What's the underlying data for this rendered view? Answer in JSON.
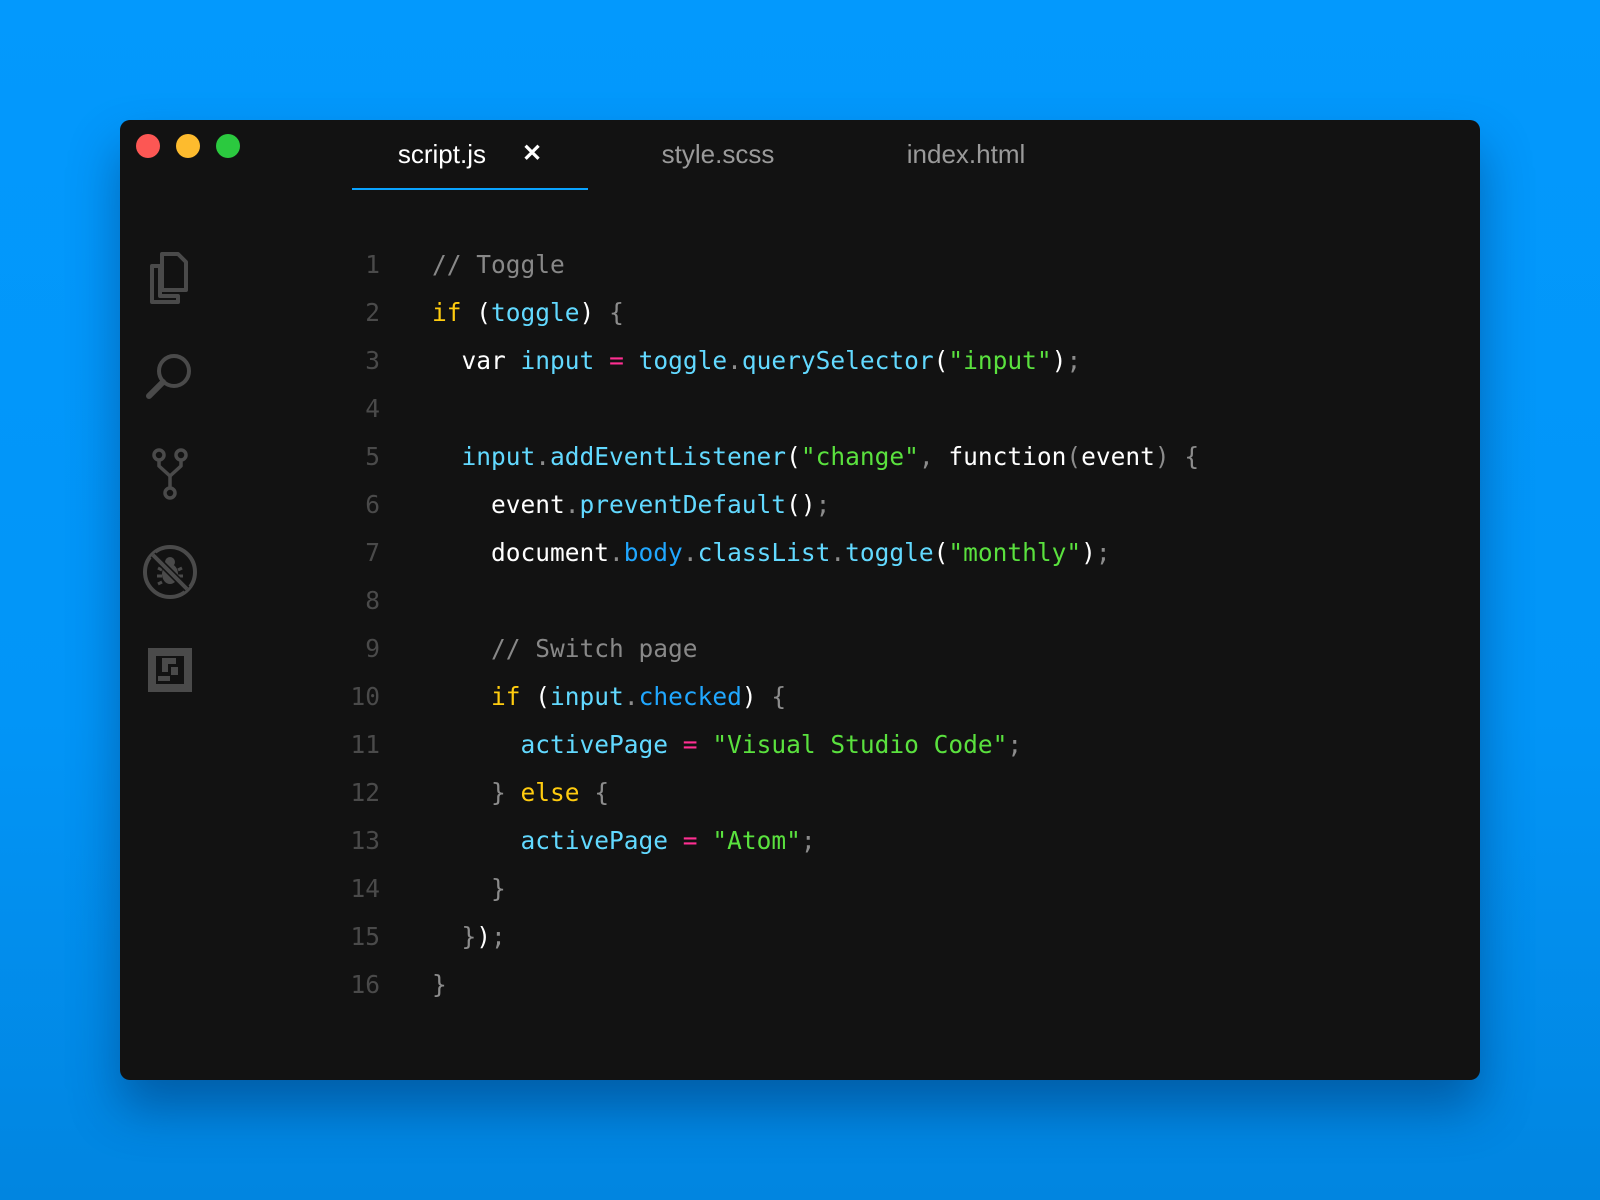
{
  "window": {
    "traffic_lights": [
      {
        "name": "close",
        "color": "#fc5754"
      },
      {
        "name": "minimize",
        "color": "#fdbb2e"
      },
      {
        "name": "zoom",
        "color": "#2bc93f"
      }
    ]
  },
  "tabs": [
    {
      "label": "script.js",
      "active": true,
      "close_glyph": "✕"
    },
    {
      "label": "style.scss",
      "active": false
    },
    {
      "label": "index.html",
      "active": false
    }
  ],
  "activity_bar": [
    {
      "icon": "files-icon"
    },
    {
      "icon": "search-icon"
    },
    {
      "icon": "source-control-icon"
    },
    {
      "icon": "debug-icon"
    },
    {
      "icon": "extensions-icon"
    }
  ],
  "theme": {
    "background": "#121212",
    "accent": "#0aa3ff",
    "comment": "#888888",
    "keyword": "#ffcc0f",
    "identifier": "#62d9ff",
    "operator": "#ff2f92",
    "string": "#5ae13e",
    "property": "#20a7ff"
  },
  "code": {
    "lines": [
      {
        "n": "1",
        "tokens": [
          [
            "// Toggle",
            "comment"
          ]
        ]
      },
      {
        "n": "2",
        "tokens": [
          [
            "if",
            "kw"
          ],
          [
            " (",
            "white"
          ],
          [
            "toggle",
            "var"
          ],
          [
            ")",
            "white"
          ],
          [
            " {",
            "dim"
          ]
        ]
      },
      {
        "n": "3",
        "tokens": [
          [
            "  ",
            "white"
          ],
          [
            "var",
            "white"
          ],
          [
            " ",
            "white"
          ],
          [
            "input",
            "var"
          ],
          [
            " ",
            "white"
          ],
          [
            "=",
            "pink"
          ],
          [
            " ",
            "white"
          ],
          [
            "toggle",
            "var"
          ],
          [
            ".",
            "dim"
          ],
          [
            "querySelector",
            "var"
          ],
          [
            "(",
            "white"
          ],
          [
            "\"input\"",
            "str"
          ],
          [
            ")",
            "white"
          ],
          [
            ";",
            "dim"
          ]
        ]
      },
      {
        "n": "4",
        "tokens": []
      },
      {
        "n": "5",
        "tokens": [
          [
            "  ",
            "white"
          ],
          [
            "input",
            "var"
          ],
          [
            ".",
            "dim"
          ],
          [
            "addEventListener",
            "var"
          ],
          [
            "(",
            "white"
          ],
          [
            "\"change\"",
            "str"
          ],
          [
            ", ",
            "dim"
          ],
          [
            "function",
            "white"
          ],
          [
            "(",
            "dim"
          ],
          [
            "event",
            "white"
          ],
          [
            ")",
            "dim"
          ],
          [
            " {",
            "dim"
          ]
        ]
      },
      {
        "n": "6",
        "tokens": [
          [
            "    ",
            "white"
          ],
          [
            "event",
            "white"
          ],
          [
            ".",
            "dim"
          ],
          [
            "preventDefault",
            "var"
          ],
          [
            "()",
            "white"
          ],
          [
            ";",
            "dim"
          ]
        ]
      },
      {
        "n": "7",
        "tokens": [
          [
            "    ",
            "white"
          ],
          [
            "document",
            "white"
          ],
          [
            ".",
            "dim"
          ],
          [
            "body",
            "prop"
          ],
          [
            ".",
            "dim"
          ],
          [
            "classList",
            "var"
          ],
          [
            ".",
            "dim"
          ],
          [
            "toggle",
            "var"
          ],
          [
            "(",
            "white"
          ],
          [
            "\"monthly\"",
            "str"
          ],
          [
            ")",
            "white"
          ],
          [
            ";",
            "dim"
          ]
        ]
      },
      {
        "n": "8",
        "tokens": []
      },
      {
        "n": "9",
        "tokens": [
          [
            "    ",
            "white"
          ],
          [
            "// Switch page",
            "comment"
          ]
        ]
      },
      {
        "n": "10",
        "tokens": [
          [
            "    ",
            "white"
          ],
          [
            "if",
            "kw"
          ],
          [
            " (",
            "white"
          ],
          [
            "input",
            "var"
          ],
          [
            ".",
            "dim"
          ],
          [
            "checked",
            "prop"
          ],
          [
            ")",
            "white"
          ],
          [
            " {",
            "dim"
          ]
        ]
      },
      {
        "n": "11",
        "tokens": [
          [
            "      ",
            "white"
          ],
          [
            "activePage",
            "var"
          ],
          [
            " ",
            "white"
          ],
          [
            "=",
            "pink"
          ],
          [
            " ",
            "white"
          ],
          [
            "\"Visual Studio Code\"",
            "str"
          ],
          [
            ";",
            "dim"
          ]
        ]
      },
      {
        "n": "12",
        "tokens": [
          [
            "    ",
            "white"
          ],
          [
            "}",
            "dim"
          ],
          [
            " ",
            "white"
          ],
          [
            "else",
            "kw"
          ],
          [
            " {",
            "dim"
          ]
        ]
      },
      {
        "n": "13",
        "tokens": [
          [
            "      ",
            "white"
          ],
          [
            "activePage",
            "var"
          ],
          [
            " ",
            "white"
          ],
          [
            "=",
            "pink"
          ],
          [
            " ",
            "white"
          ],
          [
            "\"Atom\"",
            "str"
          ],
          [
            ";",
            "dim"
          ]
        ]
      },
      {
        "n": "14",
        "tokens": [
          [
            "    ",
            "white"
          ],
          [
            "}",
            "dim"
          ]
        ]
      },
      {
        "n": "15",
        "tokens": [
          [
            "  ",
            "white"
          ],
          [
            "}",
            "dim"
          ],
          [
            ")",
            "white"
          ],
          [
            ";",
            "dim"
          ]
        ]
      },
      {
        "n": "16",
        "tokens": [
          [
            "}",
            "dim"
          ]
        ]
      }
    ]
  }
}
